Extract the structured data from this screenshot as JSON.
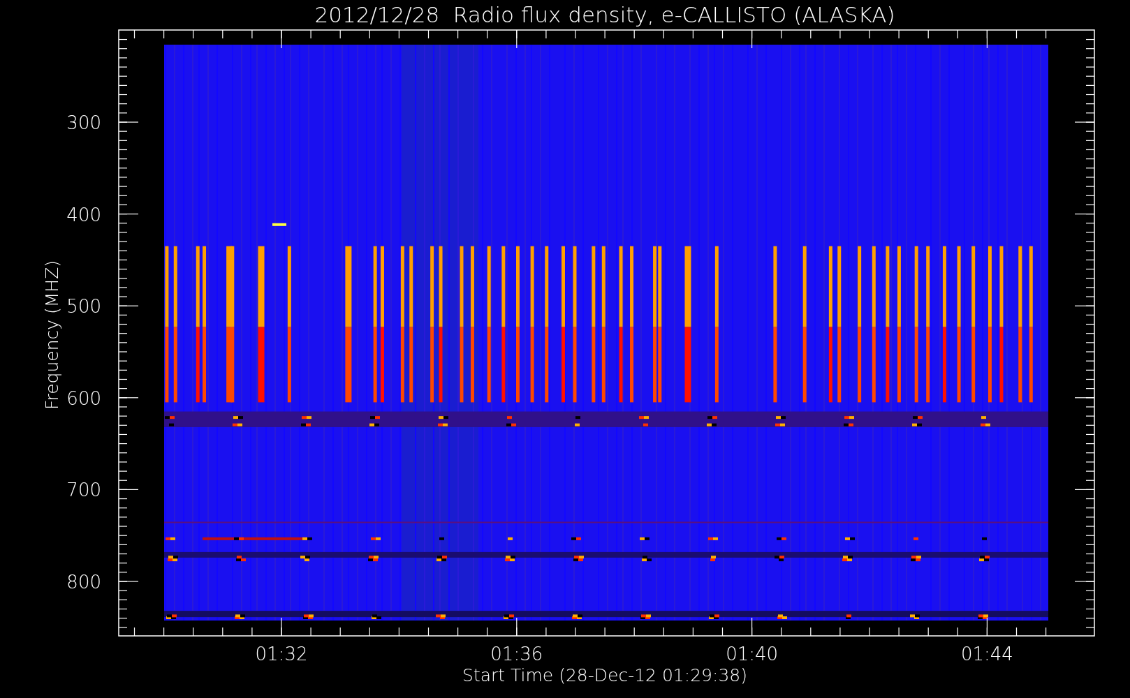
{
  "title": "2012/12/28  Radio flux density, e-CALLISTO (ALASKA)",
  "y_axis": {
    "label": "Frequency (MHZ)",
    "ticks": [
      "300",
      "400",
      "500",
      "600",
      "700",
      "800"
    ]
  },
  "x_axis": {
    "label": "Start Time (28-Dec-12 01:29:38)",
    "ticks": [
      "01:32",
      "01:36",
      "01:40",
      "01:44"
    ]
  }
}
